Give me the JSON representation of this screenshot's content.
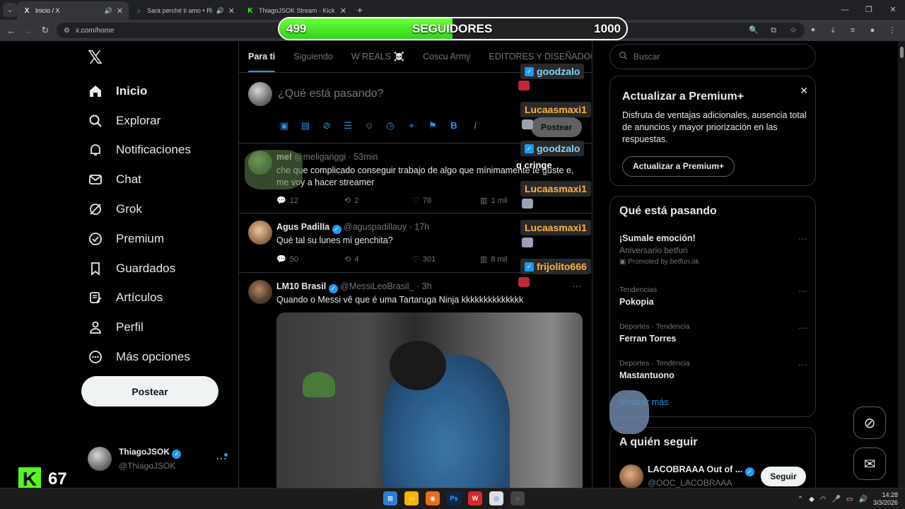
{
  "browser": {
    "tabs": [
      {
        "title": "Inicio / X",
        "favicon": "X",
        "active": true
      },
      {
        "title": "Sarà perché ti amo • Ricchi",
        "favicon": "♪",
        "active": false
      },
      {
        "title": "ThiagoJSOK Stream - Kick Dash",
        "favicon": "K",
        "active": false
      }
    ],
    "url": "x.com/home"
  },
  "overlay": {
    "followers_current": "499",
    "followers_label": "SEGUIDORES",
    "followers_goal": "1000",
    "followers_fraction": 0.499,
    "kick_count": "67",
    "chat": [
      {
        "user": "goodzalo",
        "color": "blue",
        "badge": true
      },
      {
        "user": "Lucaasmaxi1",
        "color": "orange",
        "badge": false
      },
      {
        "user": "goodzalo",
        "color": "blue",
        "badge": true
      },
      {
        "user": "Lucaasmaxi1",
        "color": "orange",
        "badge": false
      },
      {
        "user": "Lucaasmaxi1",
        "color": "orange",
        "badge": false
      },
      {
        "user": "frijolito666",
        "color": "orange",
        "badge": true
      }
    ],
    "chat_message": "q cringe"
  },
  "nav": {
    "items": [
      {
        "label": "Inicio",
        "icon": "home-icon"
      },
      {
        "label": "Explorar",
        "icon": "search-icon"
      },
      {
        "label": "Notificaciones",
        "icon": "bell-icon"
      },
      {
        "label": "Chat",
        "icon": "mail-icon"
      },
      {
        "label": "Grok",
        "icon": "grok-icon"
      },
      {
        "label": "Premium",
        "icon": "premium-icon"
      },
      {
        "label": "Guardados",
        "icon": "bookmark-icon"
      },
      {
        "label": "Artículos",
        "icon": "article-icon"
      },
      {
        "label": "Perfil",
        "icon": "person-icon"
      },
      {
        "label": "Más opciones",
        "icon": "more-icon"
      }
    ],
    "post_label": "Postear",
    "account": {
      "name": "ThiagoJSOK",
      "handle": "@ThiagoJSOK"
    }
  },
  "timeline": {
    "tabs": [
      "Para ti",
      "Siguiendo",
      "W REALS ☠️",
      "Coscu Army",
      "EDITORES Y DISEÑADOR"
    ],
    "composer_placeholder": "¿Qué está pasando?",
    "composer_post_label": "Postear",
    "posts": [
      {
        "name": "mel",
        "handle": "@meliganggi",
        "time": "53min",
        "text": "che que complicado conseguir trabajo de algo que mínimamente te guste e, me voy a hacer streamer",
        "replies": "12",
        "reposts": "2",
        "likes": "78",
        "views": "1 mil",
        "verified": false
      },
      {
        "name": "Agus Padilla",
        "handle": "@aguspadillauy",
        "time": "17h",
        "text": "Qué tal su lunes mi genchita?",
        "replies": "50",
        "reposts": "4",
        "likes": "301",
        "views": "8 mil",
        "verified": true
      },
      {
        "name": "LM10 Brasil",
        "handle": "@MessiLeoBrasil_",
        "time": "3h",
        "text": "Quando o Messi vê que é uma Tartaruga Ninja kkkkkkkkkkkkkk",
        "verified": true
      }
    ]
  },
  "sidebar": {
    "search_placeholder": "Buscar",
    "premium": {
      "title": "Actualizar a Premium+",
      "desc": "Disfruta de ventajas adicionales, ausencia total de anuncios y mayor priorización en las respuestas.",
      "button": "Actualizar a Premium+"
    },
    "trends_title": "Qué está pasando",
    "trends": [
      {
        "meta": "",
        "name": "¡Sumale emoción!",
        "sub": "Aniversario betfun",
        "promo": "Promoted by betfun.ok"
      },
      {
        "meta": "Tendencias",
        "name": "Pokopia",
        "sub": "",
        "promo": ""
      },
      {
        "meta": "Deportes · Tendencia",
        "name": "Ferran Torres",
        "sub": "",
        "promo": ""
      },
      {
        "meta": "Deportes · Tendencia",
        "name": "Mastantuono",
        "sub": "",
        "promo": ""
      }
    ],
    "show_more": "Mostrar más",
    "who_title": "A quién seguir",
    "who": {
      "name": "LACOBRAAA Out of ...",
      "handle": "@OOC_LACOBRAAA",
      "button": "Seguir"
    }
  },
  "taskbar": {
    "time": "14:28",
    "date": "3/3/2026"
  }
}
